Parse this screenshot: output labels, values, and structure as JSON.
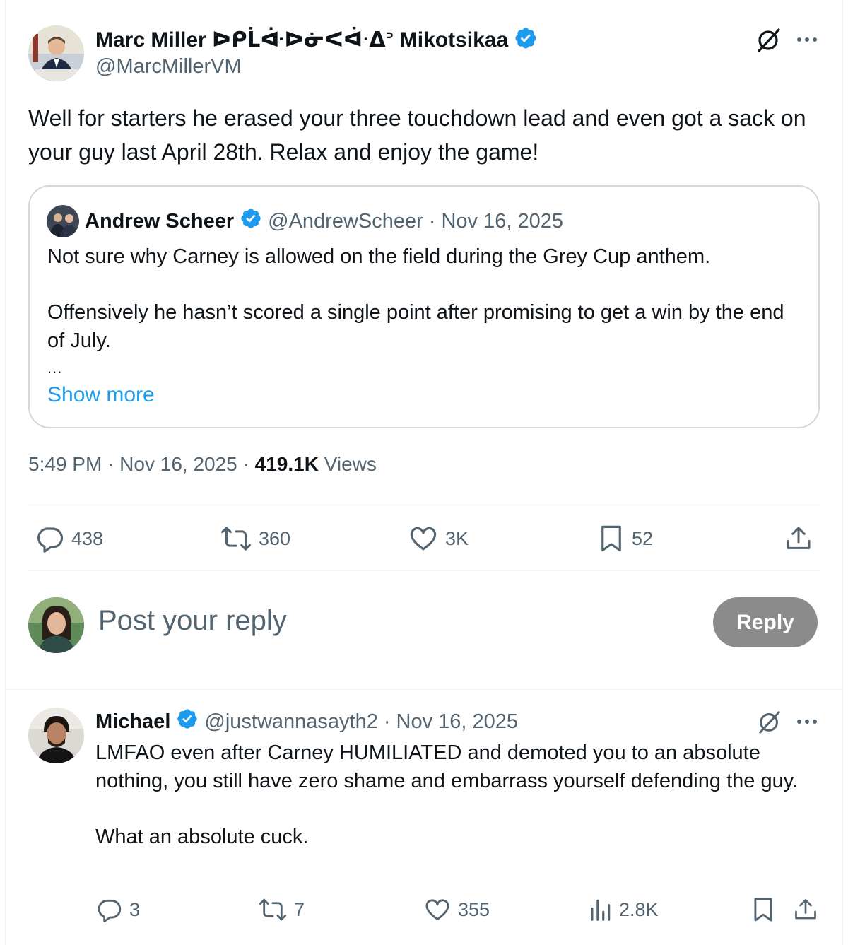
{
  "post": {
    "author_name": "Marc Miller ᐅᑭᒫᐚᐅᓃᐸᐋᐧᐃᐣ Mikotsikaa",
    "handle": "@MarcMillerVM",
    "text": "Well for starters he erased your three touchdown lead and even got a sack on your guy last April 28th. Relax and enjoy the game!",
    "time": "5:49 PM",
    "date": "Nov 16, 2025",
    "views_count": "419.1K",
    "views_label": "Views",
    "stats": {
      "replies": "438",
      "reposts": "360",
      "likes": "3K",
      "bookmarks": "52"
    }
  },
  "quote": {
    "author_name": "Andrew Scheer",
    "handle": "@AndrewScheer",
    "separator": "·",
    "date": "Nov 16, 2025",
    "paragraph1": "Not sure why Carney is allowed on the field during the Grey Cup anthem.",
    "paragraph2": "Offensively he hasn’t scored a single point after promising to get a win by the end of July.",
    "ellipsis": "...",
    "show_more": "Show more"
  },
  "reply_composer": {
    "placeholder": "Post your reply",
    "button_label": "Reply"
  },
  "reply": {
    "author_name": "Michael",
    "handle": "@justwannasayth2",
    "separator": "·",
    "date": "Nov 16, 2025",
    "paragraph1": "LMFAO even after Carney HUMILIATED and demoted you to an absolute nothing, you still have zero shame and embarrass yourself defending the guy.",
    "paragraph2": "What an absolute cuck.",
    "stats": {
      "replies": "3",
      "reposts": "7",
      "likes": "355",
      "views": "2.8K"
    }
  },
  "colors": {
    "verified": "#1d9bf0",
    "link": "#1d9bf0",
    "muted": "#536471",
    "reply_button": "#8b8b8b"
  },
  "icons": {
    "grok": "grok-icon",
    "more": "more-icon",
    "reply": "reply-icon",
    "repost": "repost-icon",
    "like": "heart-icon",
    "bookmark": "bookmark-icon",
    "share": "share-icon",
    "views": "views-icon",
    "verified": "verified-badge-icon"
  }
}
